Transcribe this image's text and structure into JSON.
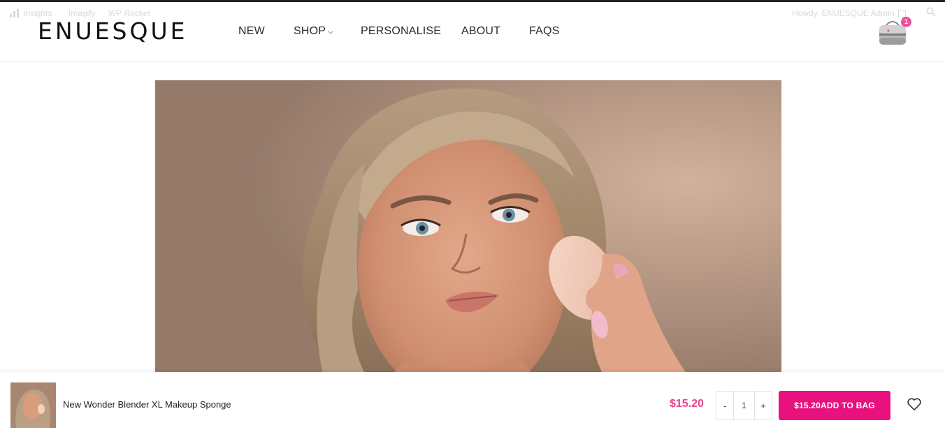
{
  "admin_bar": {
    "insights": "Insights",
    "imagify": "Imagify",
    "wp_rocket": "WP Rocket",
    "howdy": "Howdy, ENUESQUE Admin"
  },
  "header": {
    "logo": "ENUESQUE",
    "nav": {
      "new": "NEW",
      "shop": "SHOP",
      "personalise": "PERSONALISE",
      "about": "ABOUT",
      "faqs": "FAQS"
    },
    "cart_count": "1",
    "accent_color": "#e8117e"
  },
  "hero": {
    "image_subject": "model-holding-makeup-sponge"
  },
  "sticky_bar": {
    "product_title": "New Wonder Blender XL Makeup Sponge",
    "price": "$15.20",
    "qty_minus": "-",
    "qty_value": "1",
    "qty_plus": "+",
    "add_button": "$15.20ADD TO BAG"
  },
  "icons": [
    "bar-chart-icon",
    "search-icon",
    "shopping-bag-icon",
    "heart-icon",
    "chevron-down-icon"
  ]
}
